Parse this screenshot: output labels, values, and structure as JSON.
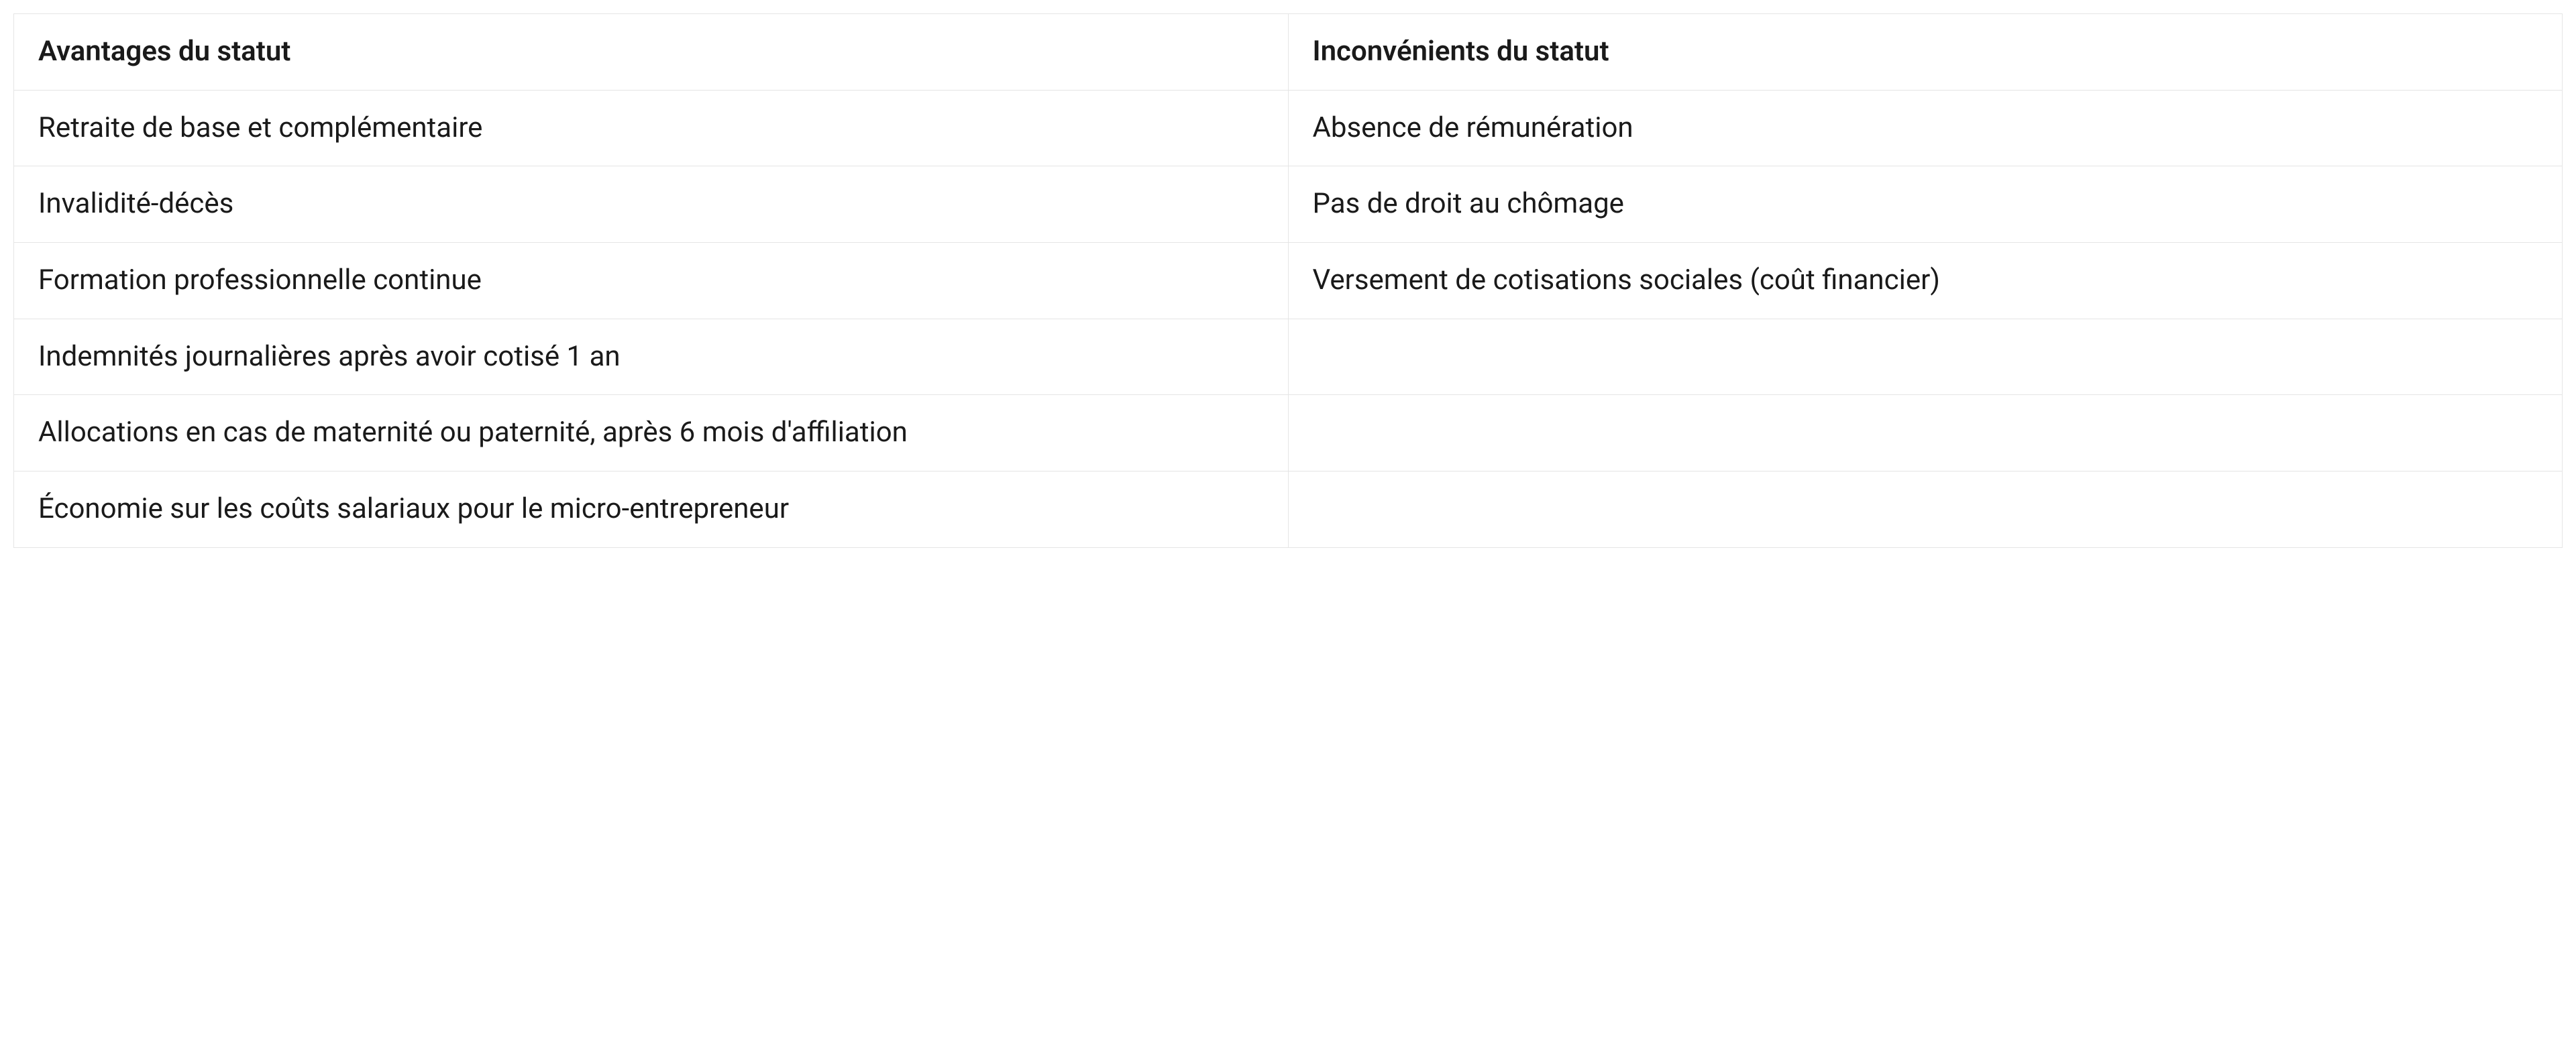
{
  "chart_data": {
    "type": "table",
    "headers": [
      "Avantages du statut",
      "Inconvénients du statut"
    ],
    "rows": [
      [
        "Retraite de base et complémentaire",
        "Absence de rémunération"
      ],
      [
        "Invalidité-décès",
        "Pas de droit au chômage"
      ],
      [
        "Formation professionnelle continue",
        "Versement de cotisations sociales (coût financier)"
      ],
      [
        "Indemnités journalières après avoir cotisé 1 an",
        ""
      ],
      [
        "Allocations en cas de maternité ou paternité, après 6 mois d'affiliation",
        ""
      ],
      [
        "Économie sur les coûts salariaux pour le micro-entrepreneur",
        ""
      ]
    ]
  }
}
